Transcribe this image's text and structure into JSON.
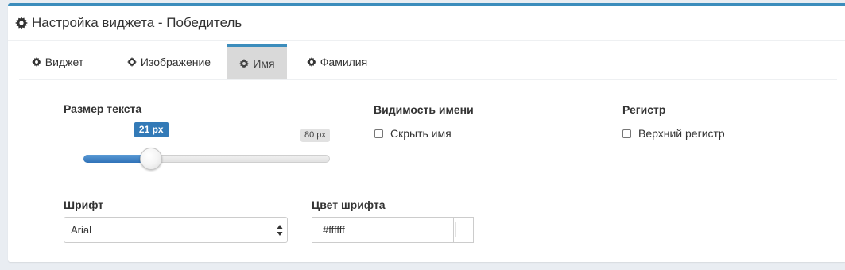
{
  "panel": {
    "title": "Настройка виджета - Победитель",
    "header_icon": "gear-icon"
  },
  "tabs": [
    {
      "label": "Виджет",
      "icon": "gear-icon",
      "active": false
    },
    {
      "label": "Изображение",
      "icon": "gear-icon",
      "active": false
    },
    {
      "label": "Имя",
      "icon": "gear-icon",
      "active": true
    },
    {
      "label": "Фамилия",
      "icon": "gear-icon",
      "active": false
    }
  ],
  "text_size": {
    "label": "Размер текста",
    "value_label": "21 px",
    "max_label": "80 px",
    "value": 21,
    "max": 80,
    "accent_color": "#337ab7"
  },
  "name_visibility": {
    "label": "Видимость имени",
    "checkbox_label": "Скрыть имя",
    "checked": false
  },
  "register": {
    "label": "Регистр",
    "checkbox_label": "Верхний регистр",
    "checked": false
  },
  "font": {
    "label": "Шрифт",
    "selected": "Arial"
  },
  "font_color": {
    "label": "Цвет шрифта",
    "value": "#ffffff",
    "swatch_color": "#ffffff"
  },
  "colors": {
    "accent": "#3c8dbc",
    "active_tab_bg": "#d9d9d9"
  }
}
